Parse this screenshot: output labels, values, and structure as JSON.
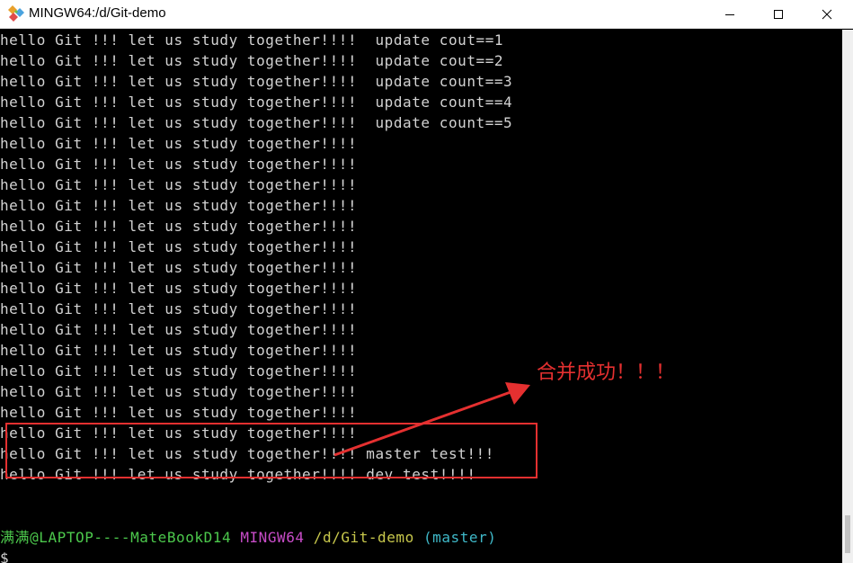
{
  "window": {
    "title": "MINGW64:/d/Git-demo",
    "min_symbol": "—",
    "max_symbol": "☐",
    "close_symbol": "✕"
  },
  "terminal": {
    "lines": [
      "hello Git !!! let us study together!!!!  update cout==1",
      "hello Git !!! let us study together!!!!  update cout==2",
      "hello Git !!! let us study together!!!!  update count==3",
      "hello Git !!! let us study together!!!!  update count==4",
      "hello Git !!! let us study together!!!!  update count==5",
      "hello Git !!! let us study together!!!!",
      "hello Git !!! let us study together!!!!",
      "hello Git !!! let us study together!!!!",
      "hello Git !!! let us study together!!!!",
      "hello Git !!! let us study together!!!!",
      "hello Git !!! let us study together!!!!",
      "hello Git !!! let us study together!!!!",
      "hello Git !!! let us study together!!!!",
      "hello Git !!! let us study together!!!!",
      "hello Git !!! let us study together!!!!",
      "hello Git !!! let us study together!!!!",
      "hello Git !!! let us study together!!!!",
      "hello Git !!! let us study together!!!!",
      "hello Git !!! let us study together!!!!",
      "hello Git !!! let us study together!!!!",
      "hello Git !!! let us study together!!!! master test!!!",
      "hello Git !!! let us study together!!!! dev test!!!!"
    ],
    "prompt": {
      "user": "满满@LAPTOP----MateBookD14",
      "system": "MINGW64",
      "path": "/d/Git-demo",
      "branch": "(master)"
    },
    "cursor": "$"
  },
  "annotation": {
    "text": "合并成功！！！",
    "color": "#e53030"
  },
  "colors": {
    "terminal_bg": "#000000",
    "terminal_fg": "#d3d3d3",
    "prompt_user": "#4cc84c",
    "prompt_system": "#c84cc8",
    "prompt_path": "#c8c84c",
    "prompt_branch": "#3fb8c8"
  }
}
